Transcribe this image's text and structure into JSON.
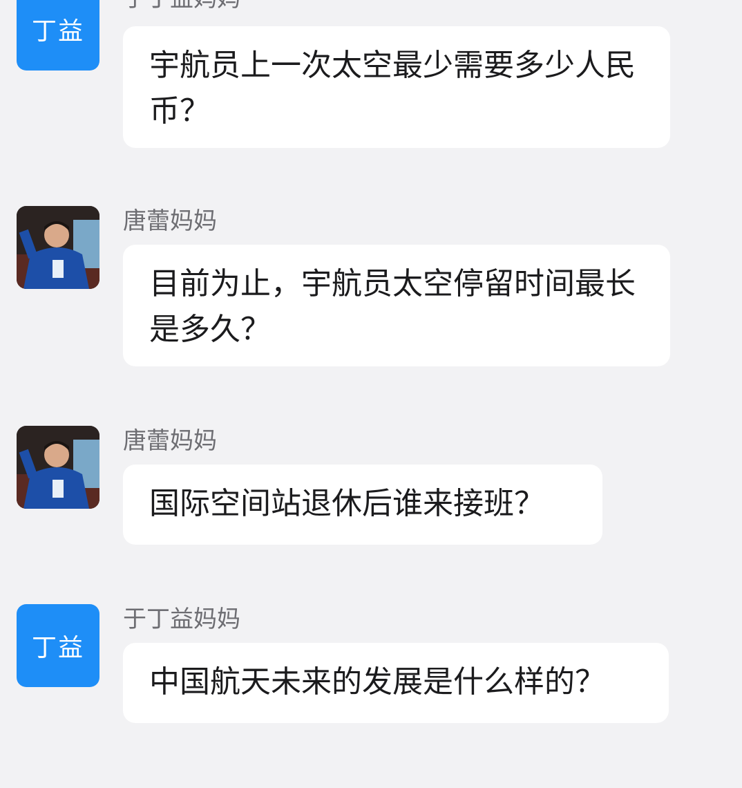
{
  "messages": [
    {
      "sender": "于丁益妈妈",
      "avatar_text": "丁益",
      "avatar_type": "text",
      "avatar_color": "#1e8ef7",
      "text": "宇航员上一次太空最少需要多少人民币？"
    },
    {
      "sender": "唐蕾妈妈",
      "avatar_type": "photo",
      "text": "目前为止，宇航员太空停留时间最长是多久？"
    },
    {
      "sender": "唐蕾妈妈",
      "avatar_type": "photo",
      "text": "国际空间站退休后谁来接班？"
    },
    {
      "sender": "于丁益妈妈",
      "avatar_text": "丁益",
      "avatar_type": "text",
      "avatar_color": "#1e8ef7",
      "text": "中国航天未来的发展是什么样的？"
    }
  ],
  "colors": {
    "background": "#f2f2f4",
    "bubble": "#ffffff",
    "sender_name": "#6d6d72",
    "message_text": "#1b1b1d",
    "accent": "#1e8ef7"
  }
}
